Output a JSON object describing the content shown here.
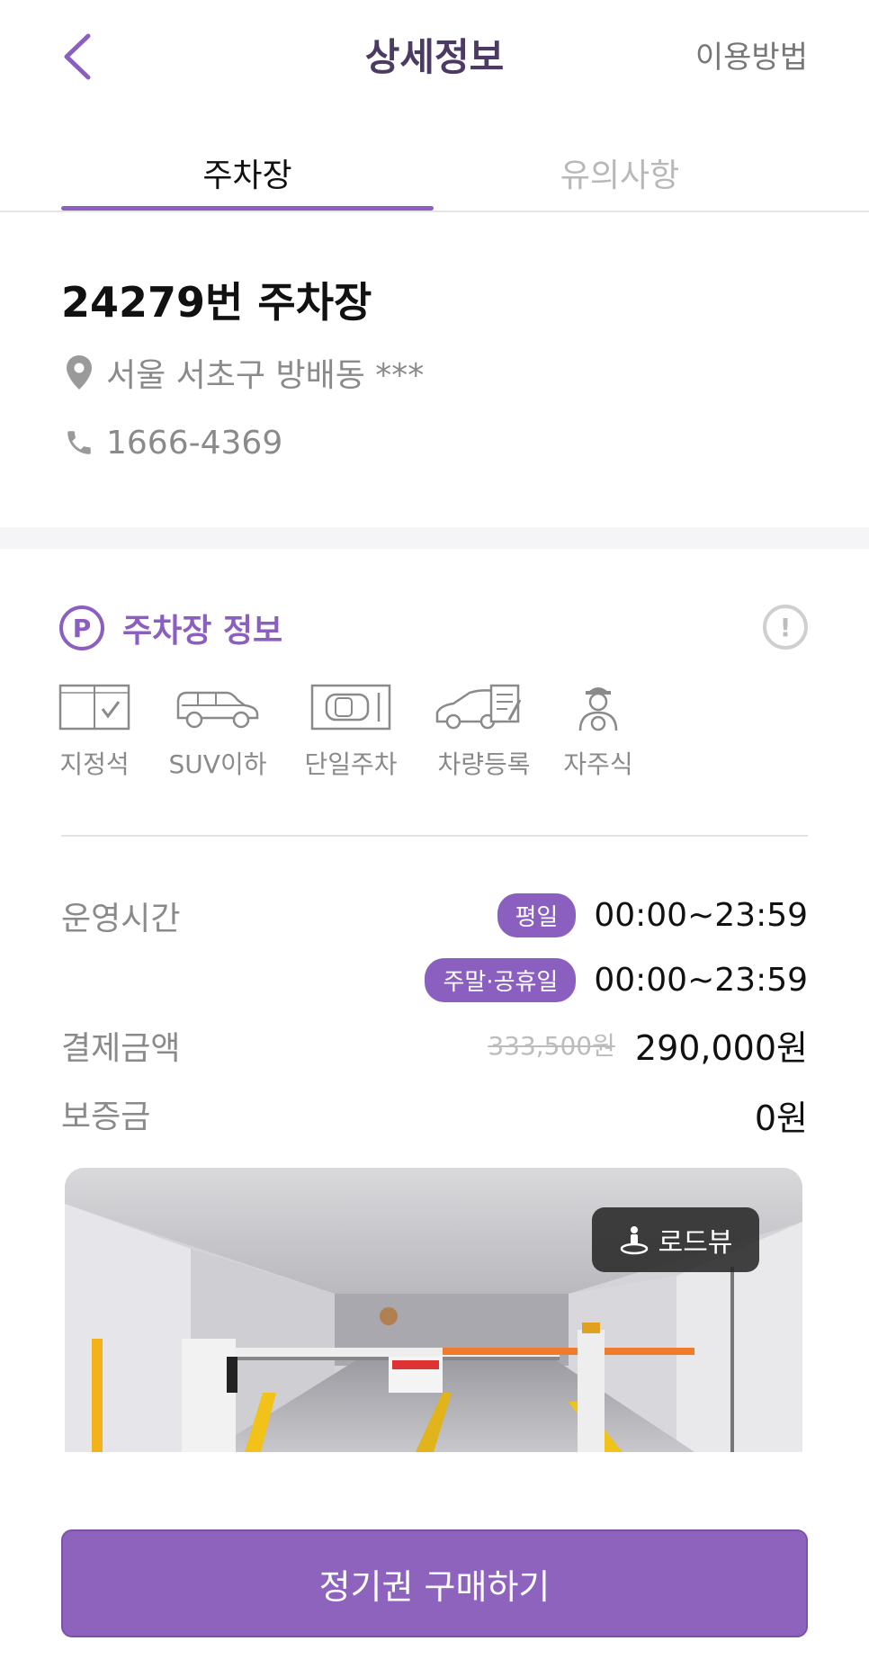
{
  "header": {
    "title": "상세정보",
    "help_label": "이용방법",
    "back_icon": "chevron-left-icon"
  },
  "tabs": [
    {
      "label": "주차장",
      "active": true
    },
    {
      "label": "유의사항",
      "active": false
    }
  ],
  "lot": {
    "name": "24279번 주차장",
    "address": "서울 서초구 방배동 ***",
    "phone": "1666-4369",
    "address_icon": "location-pin-icon",
    "phone_icon": "phone-icon"
  },
  "info": {
    "badge": "P",
    "title": "주차장 정보",
    "alert_icon": "exclamation-circle-icon",
    "features": [
      {
        "label": "지정석",
        "icon": "reserved-spot-icon"
      },
      {
        "label": "SUV이하",
        "icon": "suv-icon"
      },
      {
        "label": "단일주차",
        "icon": "single-parking-icon"
      },
      {
        "label": "차량등록",
        "icon": "car-registration-icon"
      },
      {
        "label": "자주식",
        "icon": "self-park-driver-icon"
      }
    ]
  },
  "details": {
    "hours_label": "운영시간",
    "weekday_badge": "평일",
    "weekday_hours": "00:00~23:59",
    "weekend_badge": "주말·공휴일",
    "weekend_hours": "00:00~23:59",
    "price_label": "결제금액",
    "original_price": "333,500원",
    "price": "290,000원",
    "deposit_label": "보증금",
    "deposit": "0원"
  },
  "photo": {
    "roadview_label": "로드뷰",
    "roadview_icon": "person-roadview-icon"
  },
  "cta": {
    "label": "정기권 구매하기"
  },
  "colors": {
    "accent": "#8b5fc0",
    "title": "#4b3b63",
    "muted": "#8a8a8a"
  }
}
